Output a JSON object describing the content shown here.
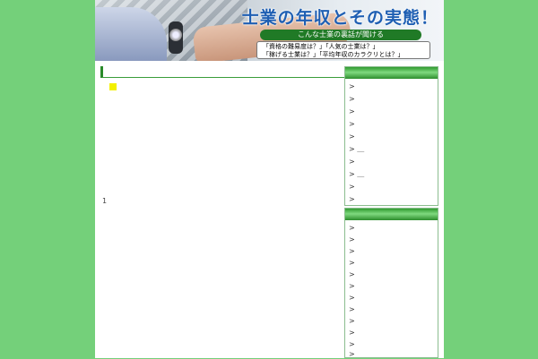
{
  "banner": {
    "title": "士業の年収とその実態！",
    "tagline": "こんな士業の裏話が聞ける",
    "questions": [
      "「資格の難易度は？」「人気の士業は？」",
      "「稼げる士業は？」「平均年収のカラクリとは？」"
    ]
  },
  "main": {
    "page_number": "1"
  },
  "sidebar": {
    "box1_items": [
      ">",
      ">",
      ">",
      ">",
      ">",
      "> ＿",
      ">",
      "> ＿",
      ">",
      ">"
    ],
    "box2_items": [
      ">",
      ">",
      ">",
      ">",
      ">",
      ">",
      ">",
      ">",
      ">",
      ">",
      ">",
      ">"
    ]
  },
  "colors": {
    "background": "#74d07a",
    "accent": "#207a26",
    "title": "#1f5fb3",
    "bullet": "#f3f000"
  }
}
